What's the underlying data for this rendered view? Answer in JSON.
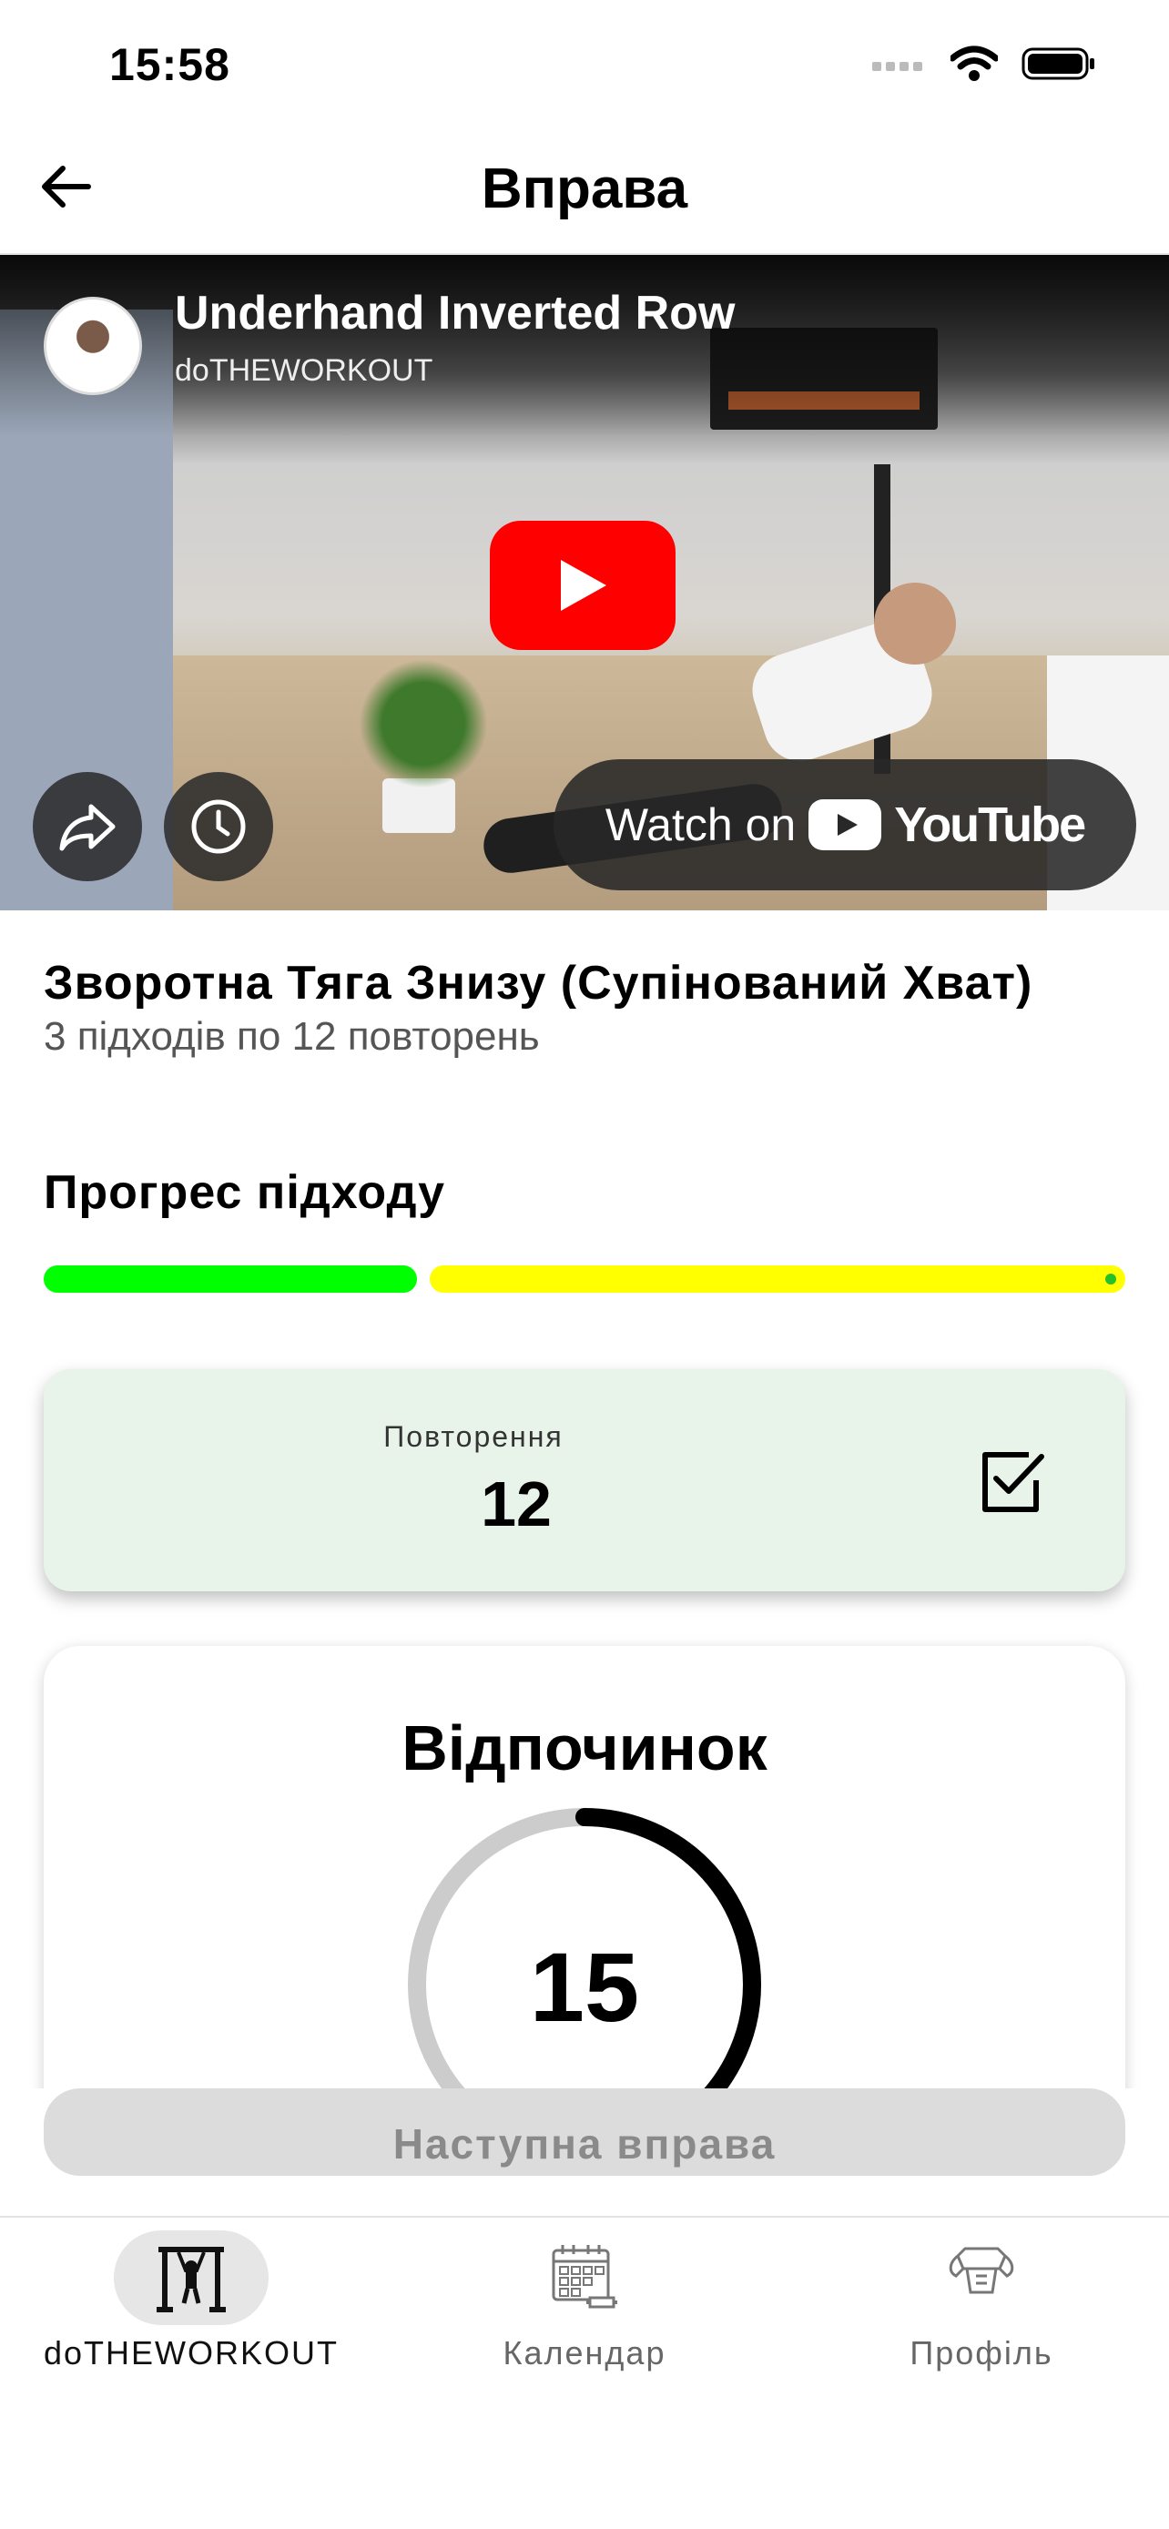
{
  "status_bar": {
    "time": "15:58"
  },
  "header": {
    "title": "Вправа",
    "back_icon": "arrow-left-icon"
  },
  "video": {
    "title": "Underhand Inverted Row",
    "channel": "doTHEWORKOUT",
    "watch_on_label": "Watch on",
    "youtube_word": "YouTube",
    "play_color": "#ff0000"
  },
  "exercise": {
    "name": "Зворотна Тяга Знизу (Супінований Хват)",
    "sets_text": "3 підходів по 12 повторень"
  },
  "progress": {
    "label": "Прогрес підходу",
    "segments": [
      {
        "color": "#00ff00",
        "state": "done"
      },
      {
        "color": "#ffff00",
        "state": "current"
      }
    ]
  },
  "reps_card": {
    "label": "Повторення",
    "value": "12"
  },
  "rest": {
    "title": "Відпочинок",
    "seconds": "15",
    "ring_fraction": 0.4
  },
  "next_button": {
    "label": "Наступна вправа"
  },
  "tabs": [
    {
      "label": "doTHEWORKOUT",
      "icon": "pullup-bar-icon",
      "active": true
    },
    {
      "label": "Календар",
      "icon": "calendar-icon",
      "active": false
    },
    {
      "label": "Профіль",
      "icon": "muscle-icon",
      "active": false
    }
  ]
}
